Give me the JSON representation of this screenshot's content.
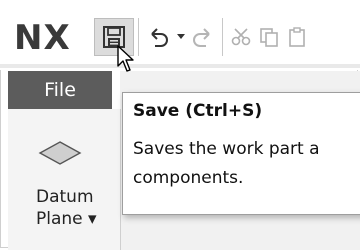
{
  "app": {
    "logo": "NX"
  },
  "toolbar": {
    "save_icon": "floppy-disk-icon",
    "undo_icon": "undo-icon",
    "undo_dropdown_icon": "chevron-down-icon",
    "redo_icon": "redo-icon",
    "cut_icon": "scissors-icon",
    "copy_icon": "copy-icon",
    "paste_icon": "paste-icon"
  },
  "ribbon": {
    "file_tab": "File",
    "datum_plane_label_line1": "Datum",
    "datum_plane_label_line2": "Plane ▾"
  },
  "tooltip": {
    "title": "Save (Ctrl+S)",
    "line1": "Saves the work part a",
    "line2": "components."
  },
  "colors": {
    "file_tab_bg": "#5c5c5c",
    "logo": "#3a3a3a",
    "save_button_highlight": "#dcdcdc"
  }
}
